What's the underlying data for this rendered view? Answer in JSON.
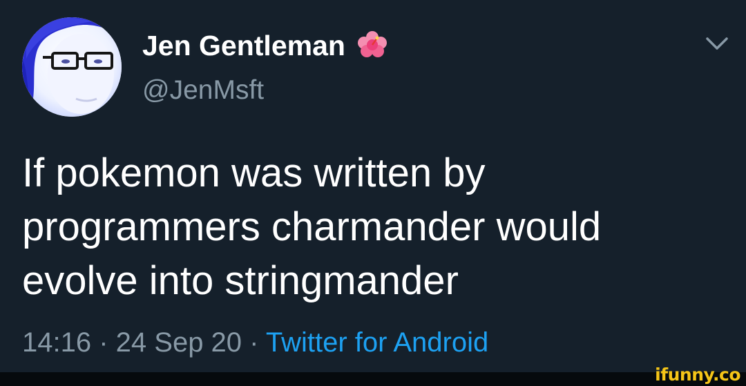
{
  "author": {
    "display_name": "Jen Gentleman",
    "name_emoji_icon": "hibiscus-flower-icon",
    "handle": "@JenMsft",
    "avatar": "avatar-photo"
  },
  "tweet": {
    "lines": [
      "If pokemon was written by",
      "programmers charmander would",
      "evolve into stringmander"
    ]
  },
  "meta": {
    "time": "14:16",
    "separator": " · ",
    "date": "24 Sep 20",
    "source": "Twitter for Android"
  },
  "menu": {
    "icon": "chevron-down-icon"
  },
  "watermark": {
    "text": "ifunny.co",
    "color": "#f5c518"
  },
  "colors": {
    "background": "#15202b",
    "text": "#ffffff",
    "secondary": "#8899a6",
    "link": "#1da1f2"
  }
}
